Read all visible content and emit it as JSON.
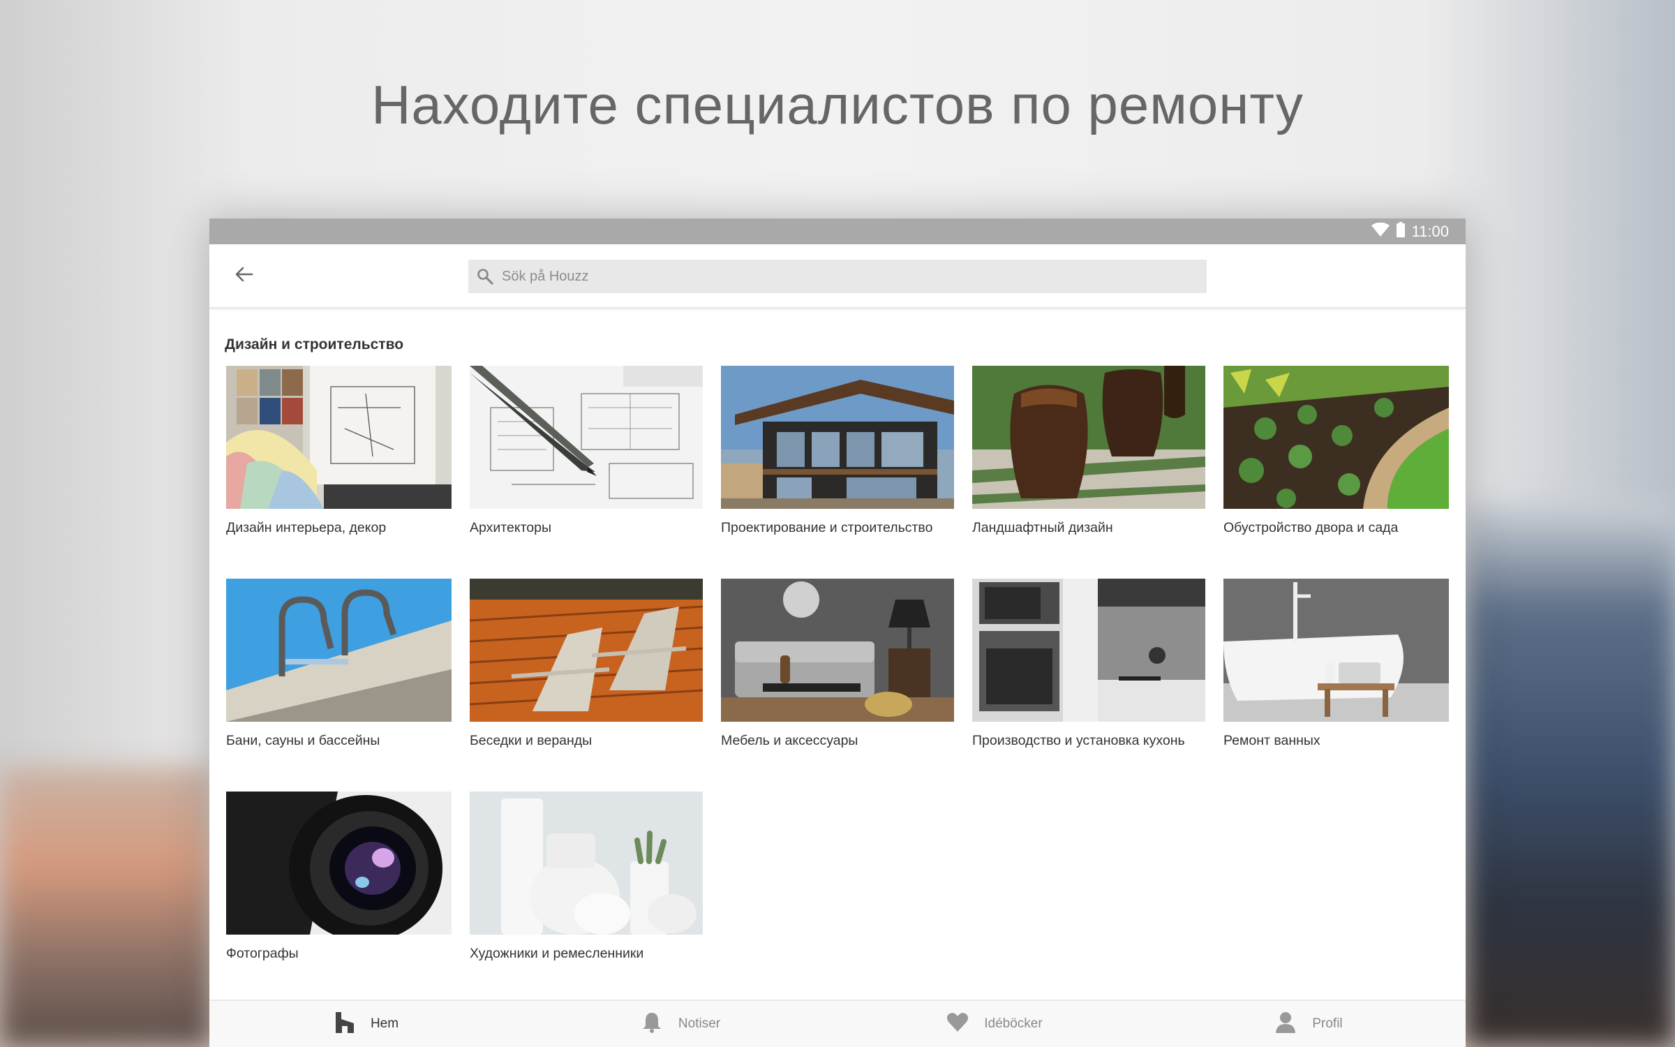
{
  "promo": {
    "headline": "Находите специалистов по ремонту"
  },
  "status_bar": {
    "time": "11:00"
  },
  "app_bar": {
    "search_placeholder": "Sök på Houzz"
  },
  "section": {
    "title": "Дизайн и строительство",
    "categories": [
      {
        "label": "Дизайн интерьера, декор"
      },
      {
        "label": "Архитекторы"
      },
      {
        "label": "Проектирование и строительство"
      },
      {
        "label": "Ландшафтный дизайн"
      },
      {
        "label": "Обустройство двора и сада"
      },
      {
        "label": "Бани, сауны и бассейны"
      },
      {
        "label": "Беседки и веранды"
      },
      {
        "label": "Мебель и аксессуары"
      },
      {
        "label": "Производство и установка кухонь"
      },
      {
        "label": "Ремонт ванных"
      },
      {
        "label": "Фотографы"
      },
      {
        "label": "Художники и ремесленники"
      }
    ]
  },
  "bottom_nav": {
    "items": [
      {
        "label": "Hem",
        "icon": "home-icon",
        "active": true
      },
      {
        "label": "Notiser",
        "icon": "bell-icon",
        "active": false
      },
      {
        "label": "Idéböcker",
        "icon": "heart-icon",
        "active": false
      },
      {
        "label": "Profil",
        "icon": "profile-icon",
        "active": false
      }
    ]
  },
  "colors": {
    "status_bar": "#a9a9a9",
    "headline": "#666666",
    "nav_active": "#333333",
    "nav_inactive": "#888888"
  }
}
